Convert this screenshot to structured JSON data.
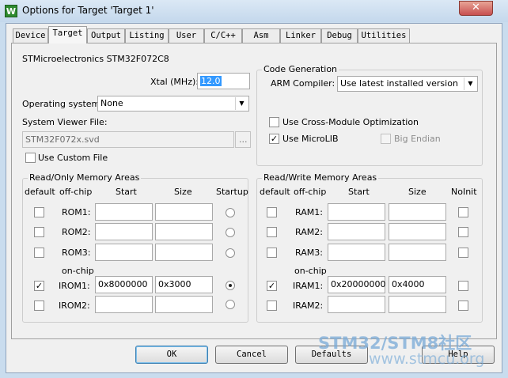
{
  "window": {
    "title": "Options for Target 'Target 1'",
    "close_glyph": "✕",
    "app_icon_glyph": "W"
  },
  "tabs": [
    "Device",
    "Target",
    "Output",
    "Listing",
    "User",
    "C/C++",
    "Asm",
    "Linker",
    "Debug",
    "Utilities"
  ],
  "active_tab": "Target",
  "device": {
    "name": "STMicroelectronics STM32F072C8",
    "xtal_label": "Xtal (MHz):",
    "xtal_value": "12.0",
    "os_label": "Operating system:",
    "os_value": "None",
    "svf_label": "System Viewer File:",
    "svf_value": "STM32F072x.svd",
    "browse_label": "...",
    "custom_file_label": "Use Custom File"
  },
  "code_generation": {
    "title": "Code Generation",
    "compiler_label": "ARM Compiler:",
    "compiler_value": "Use latest installed version",
    "cross_module_label": "Use Cross-Module Optimization",
    "microlib_label": "Use MicroLIB",
    "big_endian_label": "Big Endian"
  },
  "ro_memory": {
    "title": "Read/Only Memory Areas",
    "headers": {
      "default": "default",
      "offchip": "off-chip",
      "start": "Start",
      "size": "Size",
      "last": "Startup"
    },
    "onchip_label": "on-chip",
    "rows": [
      {
        "name": "ROM1:",
        "start": "",
        "size": "",
        "default": false,
        "radio": false
      },
      {
        "name": "ROM2:",
        "start": "",
        "size": "",
        "default": false,
        "radio": false
      },
      {
        "name": "ROM3:",
        "start": "",
        "size": "",
        "default": false,
        "radio": false
      },
      {
        "name": "IROM1:",
        "start": "0x8000000",
        "size": "0x3000",
        "default": true,
        "radio": true
      },
      {
        "name": "IROM2:",
        "start": "",
        "size": "",
        "default": false,
        "radio": false
      }
    ]
  },
  "rw_memory": {
    "title": "Read/Write Memory Areas",
    "headers": {
      "default": "default",
      "offchip": "off-chip",
      "start": "Start",
      "size": "Size",
      "last": "NoInit"
    },
    "onchip_label": "on-chip",
    "rows": [
      {
        "name": "RAM1:",
        "start": "",
        "size": "",
        "default": false
      },
      {
        "name": "RAM2:",
        "start": "",
        "size": "",
        "default": false
      },
      {
        "name": "RAM3:",
        "start": "",
        "size": "",
        "default": false
      },
      {
        "name": "IRAM1:",
        "start": "0x20000000",
        "size": "0x4000",
        "default": true
      },
      {
        "name": "IRAM2:",
        "start": "",
        "size": "",
        "default": false
      }
    ]
  },
  "buttons": {
    "ok": "OK",
    "cancel": "Cancel",
    "defaults": "Defaults",
    "help": "Help"
  },
  "watermark": {
    "brand": "STM32/STM8社区",
    "url": "www.stmcu.org"
  },
  "checks": {
    "use_custom_file": false,
    "cross_module": false,
    "microlib": true,
    "big_endian": false
  },
  "check_glyph": "✓",
  "dropdown_glyph": "▼",
  "colors": {
    "selected_text_bg": "#3399ff",
    "close_button": "#c75050"
  }
}
